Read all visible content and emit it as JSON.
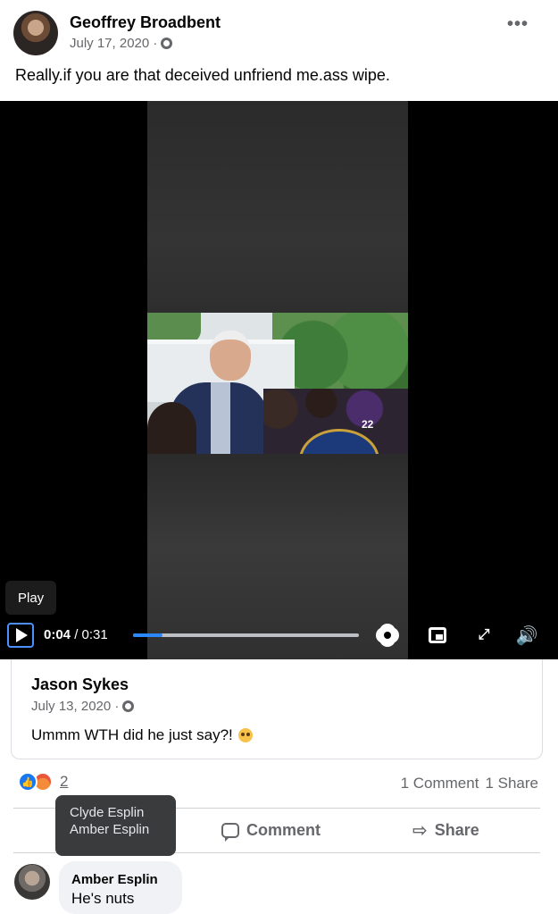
{
  "post": {
    "author": "Geoffrey Broadbent",
    "date": "July 17, 2020 ·",
    "privacy_icon": "globe-icon",
    "more_label": "•••",
    "text": "Really.if you are that deceived unfriend me.ass wipe."
  },
  "video": {
    "tooltip": "Play",
    "current_time": "0:04",
    "duration": " / 0:31",
    "progress_fraction": 0.13,
    "frame_number": "22",
    "icons": [
      "play-icon",
      "settings-icon",
      "picture-in-picture-icon",
      "fullscreen-icon",
      "volume-icon"
    ],
    "expand_glyph": "⤢",
    "volume_glyph": "🔊"
  },
  "shared_post": {
    "author": "Jason Sykes",
    "date": "July 13, 2020 ·",
    "text": "Ummm WTH did he just say?!"
  },
  "reactions": {
    "count": "2",
    "types": [
      "like",
      "angry"
    ],
    "tooltip_names": [
      "Clyde Esplin",
      "Amber Esplin"
    ]
  },
  "stats": {
    "comments": "1 Comment",
    "shares": "1 Share"
  },
  "actions": {
    "comment_label": "Comment",
    "share_label": "Share",
    "share_glyph": "⇨"
  },
  "comment": {
    "author": "Amber Esplin",
    "text": "He's nuts"
  },
  "colors": {
    "accent": "#1877f2",
    "secondary_text": "#65676b",
    "progress": "#2d88ff"
  }
}
